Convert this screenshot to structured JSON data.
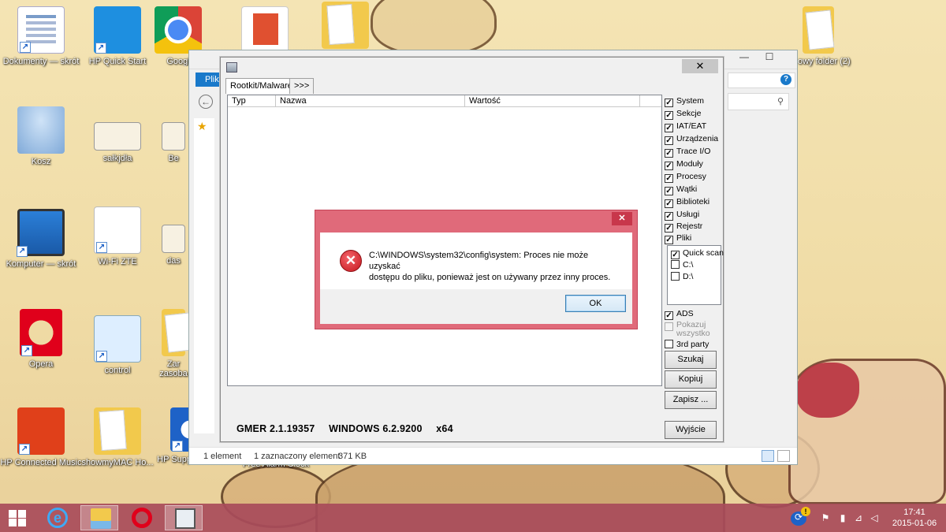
{
  "desktop": {
    "icons": [
      {
        "label": "Dokumenty — skrót"
      },
      {
        "label": "HP Quick Start"
      },
      {
        "label": "Googl"
      },
      {
        "label": ""
      },
      {
        "label": ""
      },
      {
        "label": "owy folder (2)"
      },
      {
        "label": "Kosz"
      },
      {
        "label": "sałkjdła"
      },
      {
        "label": "Be"
      },
      {
        "label": "Komputer — skrót"
      },
      {
        "label": "Wi-Fi ZTE"
      },
      {
        "label": "das"
      },
      {
        "label": "Opera"
      },
      {
        "label": "control"
      },
      {
        "label": "Zar zasoba"
      },
      {
        "label": "HP Connected Music"
      },
      {
        "label": "showmyMAC Ho..."
      },
      {
        "label": "HP Support Assistant"
      },
      {
        "label": "Free Alarm Clock"
      }
    ]
  },
  "explorer": {
    "ribbon_tab": "Plik",
    "status_items": "1 element",
    "status_selected": "1 zaznaczony element",
    "status_size": "371 KB"
  },
  "gmer": {
    "tabs": [
      "Rootkit/Malware",
      ">>>"
    ],
    "columns": [
      "Typ",
      "Nazwa",
      "Wartość"
    ],
    "checkboxes": [
      {
        "label": "System",
        "checked": true
      },
      {
        "label": "Sekcje",
        "checked": true
      },
      {
        "label": "IAT/EAT",
        "checked": true
      },
      {
        "label": "Urządzenia",
        "checked": true
      },
      {
        "label": "Trace I/O",
        "checked": true
      },
      {
        "label": "Moduły",
        "checked": true
      },
      {
        "label": "Procesy",
        "checked": true
      },
      {
        "label": "Wątki",
        "checked": true
      },
      {
        "label": "Biblioteki",
        "checked": true
      },
      {
        "label": "Usługi",
        "checked": true
      },
      {
        "label": "Rejestr",
        "checked": true
      },
      {
        "label": "Pliki",
        "checked": true
      }
    ],
    "drives": [
      {
        "label": "Quick scan",
        "checked": true
      },
      {
        "label": "C:\\",
        "checked": false
      },
      {
        "label": "D:\\",
        "checked": false
      }
    ],
    "ads": {
      "label": "ADS",
      "checked": true
    },
    "show_all": {
      "label": "Pokazuj wszystko",
      "checked": false,
      "disabled": true
    },
    "third_party": {
      "label": "3rd party",
      "checked": false
    },
    "buttons": {
      "scan": "Szukaj",
      "copy": "Kopiuj",
      "save": "Zapisz ...",
      "exit": "Wyjście"
    },
    "version": "GMER 2.1.19357",
    "os_version": "WINDOWS 6.2.9200",
    "arch": "x64"
  },
  "dialog": {
    "message_line1": "C:\\WINDOWS\\system32\\config\\system: Proces nie może uzyskać",
    "message_line2": "dostępu do pliku, ponieważ jest on używany przez inny proces.",
    "ok_label": "OK"
  },
  "taskbar": {
    "time": "17:41",
    "date": "2015-01-06",
    "pinned": [
      "windows-start",
      "internet-explorer",
      "file-explorer",
      "opera",
      "gmer"
    ]
  },
  "colors": {
    "taskbar": "#a84b5a",
    "dialog_frame": "#e06a7a",
    "explorer_accent": "#1979ca"
  }
}
